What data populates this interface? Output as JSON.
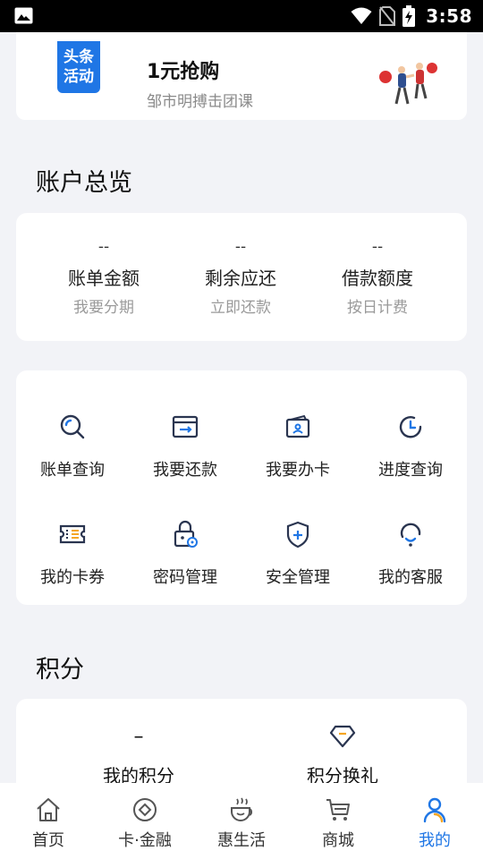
{
  "status_bar": {
    "time": "3:58"
  },
  "banner": {
    "tag_line1": "头条",
    "tag_line2": "活动",
    "title": "1元抢购",
    "subtitle": "邹市明搏击团课"
  },
  "account_overview": {
    "title": "账户总览",
    "items": [
      {
        "value": "--",
        "label": "账单金额",
        "link": "我要分期"
      },
      {
        "value": "--",
        "label": "剩余应还",
        "link": "立即还款"
      },
      {
        "value": "--",
        "label": "借款额度",
        "link": "按日计费"
      }
    ]
  },
  "services": [
    {
      "label": "账单查询",
      "icon": "search-icon"
    },
    {
      "label": "我要还款",
      "icon": "repay-card-icon"
    },
    {
      "label": "我要办卡",
      "icon": "apply-card-icon"
    },
    {
      "label": "进度查询",
      "icon": "clock-icon"
    },
    {
      "label": "我的卡券",
      "icon": "coupon-icon"
    },
    {
      "label": "密码管理",
      "icon": "lock-icon"
    },
    {
      "label": "安全管理",
      "icon": "shield-icon"
    },
    {
      "label": "我的客服",
      "icon": "headset-icon"
    }
  ],
  "points": {
    "title": "积分",
    "my_points_value": "–",
    "my_points_label": "我的积分",
    "exchange_label": "积分换礼"
  },
  "tab_bar": {
    "active": "我的",
    "items": [
      {
        "label": "首页",
        "icon": "home-icon"
      },
      {
        "label": "卡·金融",
        "icon": "card-finance-icon"
      },
      {
        "label": "惠生活",
        "icon": "coffee-cup-icon"
      },
      {
        "label": "商城",
        "icon": "cart-icon"
      },
      {
        "label": "我的",
        "icon": "person-icon"
      }
    ]
  },
  "colors": {
    "accent": "#1f76e5",
    "icon_dark": "#2a3550",
    "icon_orange": "#f5a623"
  }
}
